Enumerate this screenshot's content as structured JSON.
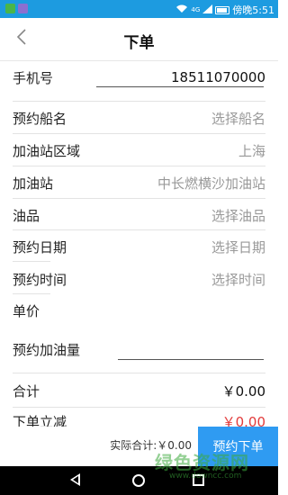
{
  "status_bar": {
    "network": "4G",
    "time_label": "傍晚5:51"
  },
  "header": {
    "title": "下单",
    "back_icon": "chevron-left-icon"
  },
  "form": {
    "phone_label": "手机号",
    "phone_value": "18511070000",
    "ship_label": "预约船名",
    "ship_placeholder": "选择船名",
    "area_label": "加油站区域",
    "area_value": "上海",
    "station_label": "加油站",
    "station_value": "中长燃横沙加油站",
    "oil_label": "油品",
    "oil_placeholder": "选择油品",
    "date_label": "预约日期",
    "date_placeholder": "选择日期",
    "time_label": "预约时间",
    "time_placeholder": "选择时间",
    "price_label": "单价",
    "qty_label": "预约加油量",
    "subtotal_label": "合计",
    "subtotal_value": "￥0.00",
    "discount_label": "下单立减",
    "discount_value": "￥0.00"
  },
  "bottom_bar": {
    "actual_total_label": "实际合计:￥0.00",
    "order_button": "预约下单"
  },
  "watermark": {
    "text": "绿色资源网",
    "sub": "www.downcc.com"
  },
  "colors": {
    "status_bar": "#1d9be0",
    "button": "#2f9bf2",
    "discount": "#e23b3b"
  }
}
